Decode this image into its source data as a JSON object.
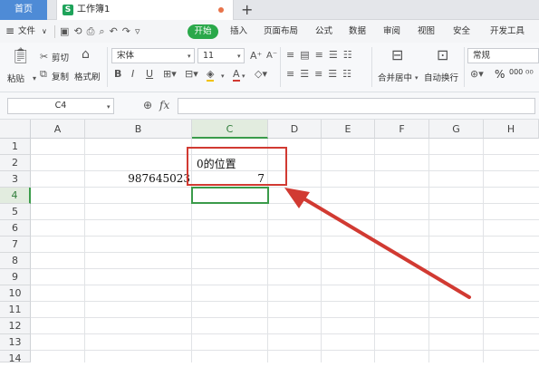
{
  "tabs": {
    "home": "首页",
    "doc_icon": "S",
    "doc_title": "工作簿1",
    "new_tab": "+"
  },
  "menu": {
    "file": "文件",
    "start": "开始",
    "items": [
      "插入",
      "页面布局",
      "公式",
      "数据",
      "审阅",
      "视图",
      "安全",
      "开发工具"
    ]
  },
  "ribbon": {
    "paste": "粘贴",
    "cut": "剪切",
    "copy": "复制",
    "format_painter": "格式刷",
    "font_name": "宋体",
    "font_size": "11",
    "merge_center": "合并居中",
    "wrap_text": "自动换行",
    "number_format": "常规",
    "percent": "%",
    "thousands": "000"
  },
  "formula_bar": {
    "name_box": "C4",
    "fx": "fx",
    "value": ""
  },
  "sheet": {
    "columns": [
      "A",
      "B",
      "C",
      "D",
      "E",
      "F",
      "G",
      "H"
    ],
    "rows": [
      "1",
      "2",
      "3",
      "4",
      "5",
      "6",
      "7",
      "8",
      "9",
      "10",
      "11",
      "12",
      "13",
      "14"
    ],
    "active_cell": "C4",
    "cells": {
      "C2": "0的位置",
      "B3": "987645023",
      "C3": "7"
    }
  },
  "colors": {
    "accent_green": "#2aa84a",
    "active_border": "#3a9b4a",
    "highlight_red": "#d13a32",
    "home_tab_blue": "#4e8bd6"
  }
}
